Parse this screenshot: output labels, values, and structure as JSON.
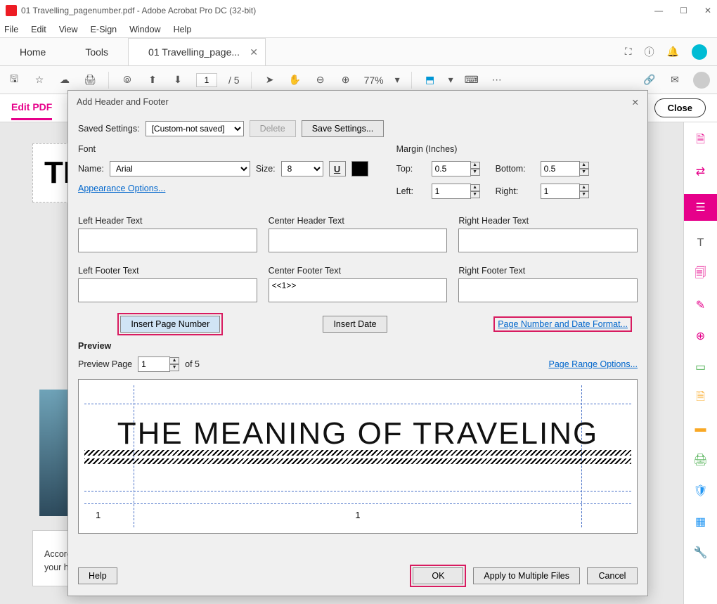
{
  "titlebar": {
    "title": "01 Travelling_pagenumber.pdf - Adobe Acrobat Pro DC (32-bit)"
  },
  "menu": {
    "items": [
      "File",
      "Edit",
      "View",
      "E-Sign",
      "Window",
      "Help"
    ]
  },
  "apptabs": {
    "home": "Home",
    "tools": "Tools",
    "doc": "01 Travelling_page..."
  },
  "toolbar": {
    "page": "1",
    "total": "/  5",
    "zoom": "77%"
  },
  "secondary": {
    "mode": "Edit PDF",
    "close": "Close"
  },
  "doc": {
    "heading": "TH",
    "para": "According ... have a ... it enhan... very important to leave your hectic office or"
  },
  "dialog": {
    "title": "Add Header and Footer",
    "saved_label": "Saved Settings:",
    "saved_value": "[Custom-not saved]",
    "delete": "Delete",
    "save_settings": "Save Settings...",
    "font_group": "Font",
    "name_label": "Name:",
    "name_value": "Arial",
    "size_label": "Size:",
    "size_value": "8",
    "appearance": "Appearance Options...",
    "margin_group": "Margin (Inches)",
    "top_label": "Top:",
    "top_value": "0.5",
    "bottom_label": "Bottom:",
    "bottom_value": "0.5",
    "left_label": "Left:",
    "left_value": "1",
    "right_label": "Right:",
    "right_value": "1",
    "lh": "Left Header Text",
    "ch": "Center Header Text",
    "rh": "Right Header Text",
    "lf": "Left Footer Text",
    "cf": "Center Footer Text",
    "rf": "Right Footer Text",
    "cf_value": "<<1>>",
    "insert_page": "Insert Page Number",
    "insert_date": "Insert Date",
    "pnf": "Page Number and Date Format...",
    "preview": "Preview",
    "preview_page_label": "Preview Page",
    "preview_page_value": "1",
    "preview_of": "of 5",
    "page_range": "Page Range Options...",
    "headline": "THE MEANING OF TRAVELING",
    "pn_left": "1",
    "pn_center": "1",
    "help": "Help",
    "ok": "OK",
    "multi": "Apply to Multiple Files",
    "cancel": "Cancel"
  }
}
